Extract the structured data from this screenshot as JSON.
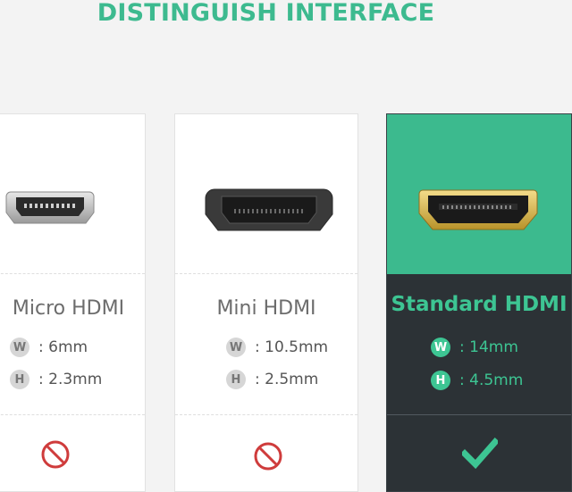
{
  "title": "DISTINGUISH INTERFACE",
  "cards": [
    {
      "name": "Micro HDMI",
      "width_label": "W",
      "width_value": ": 6mm",
      "height_label": "H",
      "height_value": ": 2.3mm",
      "status_icon": "prohibited-icon"
    },
    {
      "name": "Mini HDMI",
      "width_label": "W",
      "width_value": ": 10.5mm",
      "height_label": "H",
      "height_value": ": 2.5mm",
      "status_icon": "prohibited-icon"
    },
    {
      "name": "Standard HDMI",
      "width_label": "W",
      "width_value": ": 14mm",
      "height_label": "H",
      "height_value": ": 4.5mm",
      "status_icon": "checkmark-icon"
    }
  ],
  "colors": {
    "accent_green": "#3cba8e",
    "dark_panel": "#2c3236",
    "prohibit_red": "#cf3c3c"
  }
}
